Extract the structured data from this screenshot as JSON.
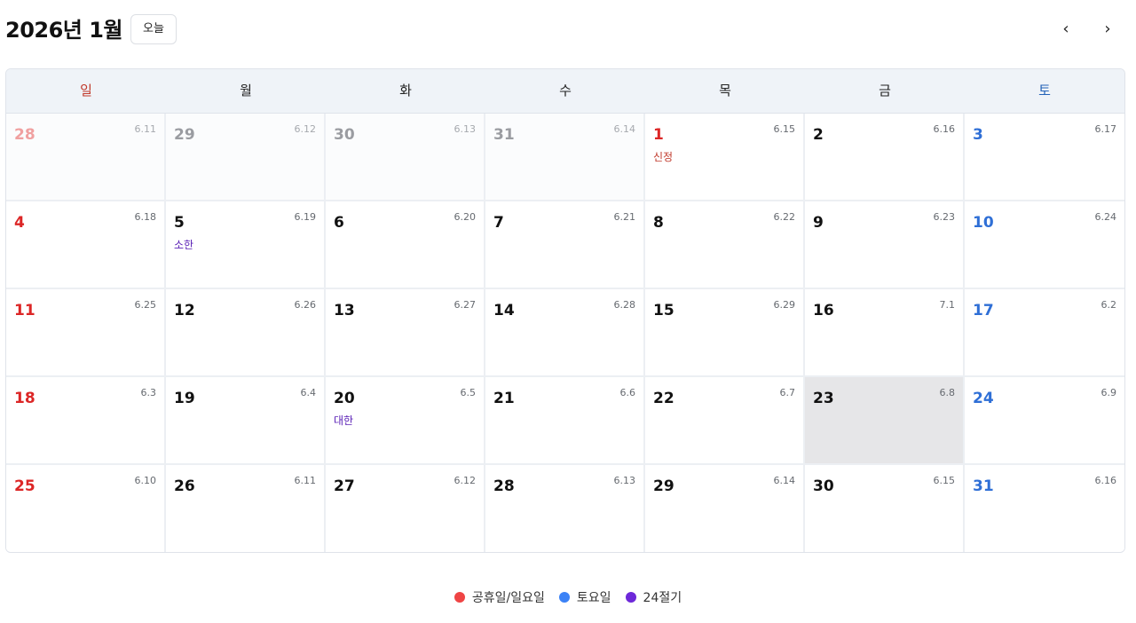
{
  "header": {
    "title": "2026년 1월",
    "today_label": "오늘",
    "prev_icon": "‹",
    "next_icon": "›"
  },
  "weekdays": [
    "일",
    "월",
    "화",
    "수",
    "목",
    "금",
    "토"
  ],
  "weeks": [
    [
      {
        "day": "28",
        "lunar": "6.11",
        "other": true
      },
      {
        "day": "29",
        "lunar": "6.12",
        "other": true
      },
      {
        "day": "30",
        "lunar": "6.13",
        "other": true
      },
      {
        "day": "31",
        "lunar": "6.14",
        "other": true
      },
      {
        "day": "1",
        "lunar": "6.15",
        "holiday": true,
        "note": "신정",
        "note_type": "holiday"
      },
      {
        "day": "2",
        "lunar": "6.16"
      },
      {
        "day": "3",
        "lunar": "6.17"
      }
    ],
    [
      {
        "day": "4",
        "lunar": "6.18"
      },
      {
        "day": "5",
        "lunar": "6.19",
        "note": "소한",
        "note_type": "term"
      },
      {
        "day": "6",
        "lunar": "6.20"
      },
      {
        "day": "7",
        "lunar": "6.21"
      },
      {
        "day": "8",
        "lunar": "6.22"
      },
      {
        "day": "9",
        "lunar": "6.23"
      },
      {
        "day": "10",
        "lunar": "6.24"
      }
    ],
    [
      {
        "day": "11",
        "lunar": "6.25"
      },
      {
        "day": "12",
        "lunar": "6.26"
      },
      {
        "day": "13",
        "lunar": "6.27"
      },
      {
        "day": "14",
        "lunar": "6.28"
      },
      {
        "day": "15",
        "lunar": "6.29"
      },
      {
        "day": "16",
        "lunar": "7.1"
      },
      {
        "day": "17",
        "lunar": "6.2"
      }
    ],
    [
      {
        "day": "18",
        "lunar": "6.3"
      },
      {
        "day": "19",
        "lunar": "6.4"
      },
      {
        "day": "20",
        "lunar": "6.5",
        "note": "대한",
        "note_type": "term"
      },
      {
        "day": "21",
        "lunar": "6.6"
      },
      {
        "day": "22",
        "lunar": "6.7"
      },
      {
        "day": "23",
        "lunar": "6.8",
        "selected": true
      },
      {
        "day": "24",
        "lunar": "6.9"
      }
    ],
    [
      {
        "day": "25",
        "lunar": "6.10"
      },
      {
        "day": "26",
        "lunar": "6.11"
      },
      {
        "day": "27",
        "lunar": "6.12"
      },
      {
        "day": "28",
        "lunar": "6.13"
      },
      {
        "day": "29",
        "lunar": "6.14"
      },
      {
        "day": "30",
        "lunar": "6.15"
      },
      {
        "day": "31",
        "lunar": "6.16"
      }
    ]
  ],
  "legend": [
    {
      "label": "공휴일/일요일",
      "color": "#ef4444"
    },
    {
      "label": "토요일",
      "color": "#3b82f6"
    },
    {
      "label": "24절기",
      "color": "#6d28d9"
    }
  ]
}
